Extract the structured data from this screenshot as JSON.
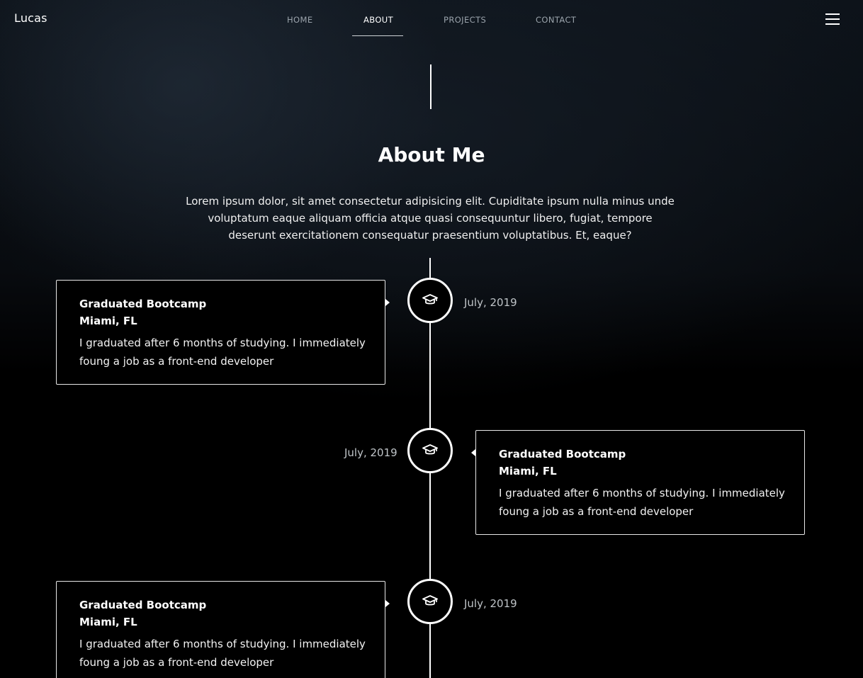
{
  "brand": "Lucas",
  "nav": {
    "items": [
      {
        "label": "HOME",
        "active": false
      },
      {
        "label": "ABOUT",
        "active": true
      },
      {
        "label": "PROJECTS",
        "active": false
      },
      {
        "label": "CONTACT",
        "active": false
      }
    ],
    "menu_icon": "hamburger-icon"
  },
  "section": {
    "title": "About Me",
    "intro": "Lorem ipsum dolor, sit amet consectetur adipisicing elit. Cupiditate ipsum nulla minus unde voluptatum eaque aliquam officia atque quasi consequuntur libero, fugiat, tempore deserunt exercitationem consequatur praesentium voluptatibus. Et, eaque?"
  },
  "timeline": [
    {
      "side": "left",
      "title": "Graduated Bootcamp",
      "location": "Miami, FL",
      "description": "I graduated after 6 months of studying. I immediately foung a job as a front-end developer",
      "date": "July, 2019",
      "icon": "graduation-cap-icon"
    },
    {
      "side": "right",
      "title": "Graduated Bootcamp",
      "location": "Miami, FL",
      "description": "I graduated after 6 months of studying. I immediately foung a job as a front-end developer",
      "date": "July, 2019",
      "icon": "graduation-cap-icon"
    },
    {
      "side": "left",
      "title": "Graduated Bootcamp",
      "location": "Miami, FL",
      "description": "I graduated after 6 months of studying. I immediately foung a job as a front-end developer",
      "date": "July, 2019",
      "icon": "graduation-cap-icon"
    }
  ],
  "colors": {
    "background": "#000000",
    "text": "#ffffff",
    "muted": "#9aa3ab",
    "date": "#bfc4c8"
  }
}
